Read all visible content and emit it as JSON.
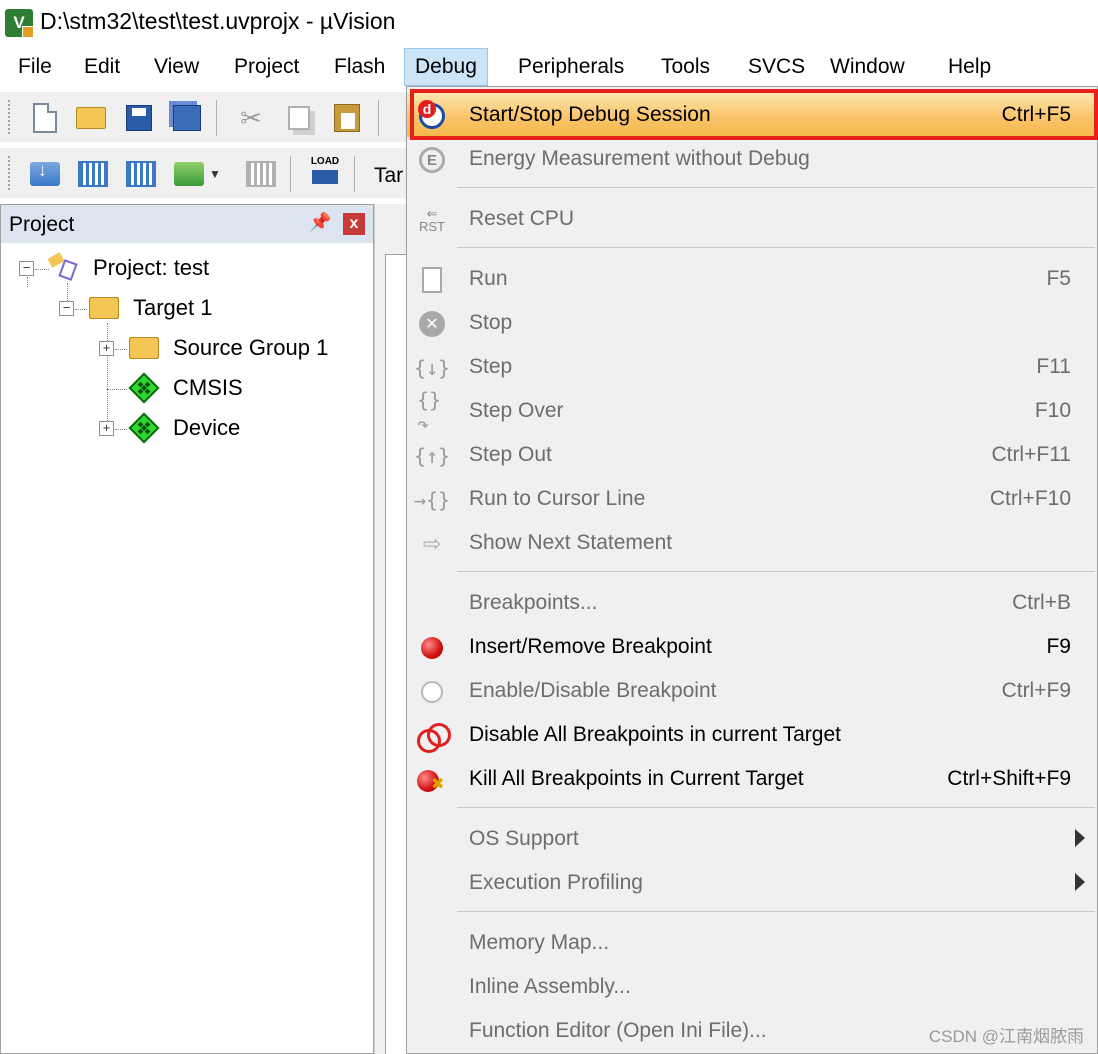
{
  "window": {
    "title": "D:\\stm32\\test\\test.uvprojx - µVision",
    "app_icon": "uvision-app-icon"
  },
  "menubar": {
    "items": [
      {
        "label": "File"
      },
      {
        "label": "Edit"
      },
      {
        "label": "View"
      },
      {
        "label": "Project"
      },
      {
        "label": "Flash"
      },
      {
        "label": "Debug",
        "active": true
      },
      {
        "label": "Peripherals"
      },
      {
        "label": "Tools"
      },
      {
        "label": "SVCS"
      },
      {
        "label": "Window"
      },
      {
        "label": "Help"
      }
    ]
  },
  "toolbar": {
    "row1_icons": [
      "new-file-icon",
      "open-folder-icon",
      "save-icon",
      "save-all-icon",
      "cut-icon",
      "copy-icon",
      "paste-icon"
    ],
    "row2_icons": [
      "translate-icon",
      "build-icon",
      "rebuild-icon",
      "batch-build-icon",
      "dropdown-arrow-icon",
      "stop-build-icon",
      "load-icon"
    ],
    "load_label": "LOAD",
    "target_partial": "Tar"
  },
  "project_panel": {
    "title": "Project",
    "pin": "⍒",
    "close": "x",
    "tree": {
      "root": "Project: test",
      "target": "Target 1",
      "children": [
        {
          "label": "Source Group 1",
          "icon": "folder-icon",
          "expandable": true
        },
        {
          "label": "CMSIS",
          "icon": "green-diamond-icon",
          "expandable": false
        },
        {
          "label": "Device",
          "icon": "green-diamond-icon",
          "expandable": true
        }
      ]
    }
  },
  "debug_menu": {
    "accent_highlight": "#f9c46a",
    "highlight_border": "#e8201c",
    "items": [
      {
        "label": "Start/Stop Debug Session",
        "shortcut": "Ctrl+F5",
        "enabled": true,
        "highlighted": true,
        "icon": "debug-session-icon"
      },
      {
        "label": "Energy Measurement without Debug",
        "shortcut": "",
        "enabled": false,
        "icon": "energy-icon"
      },
      {
        "label": "Reset CPU",
        "shortcut": "",
        "enabled": false,
        "icon": "reset-cpu-icon"
      },
      {
        "label": "Run",
        "shortcut": "F5",
        "enabled": false,
        "icon": "run-icon"
      },
      {
        "label": "Stop",
        "shortcut": "",
        "enabled": false,
        "icon": "stop-icon"
      },
      {
        "label": "Step",
        "shortcut": "F11",
        "enabled": false,
        "icon": "step-icon"
      },
      {
        "label": "Step Over",
        "shortcut": "F10",
        "enabled": false,
        "icon": "step-over-icon"
      },
      {
        "label": "Step Out",
        "shortcut": "Ctrl+F11",
        "enabled": false,
        "icon": "step-out-icon"
      },
      {
        "label": "Run to Cursor Line",
        "shortcut": "Ctrl+F10",
        "enabled": false,
        "icon": "run-to-cursor-icon"
      },
      {
        "label": "Show Next Statement",
        "shortcut": "",
        "enabled": false,
        "icon": "show-next-icon"
      },
      {
        "label": "Breakpoints...",
        "shortcut": "Ctrl+B",
        "enabled": false,
        "icon": ""
      },
      {
        "label": "Insert/Remove Breakpoint",
        "shortcut": "F9",
        "enabled": true,
        "icon": "breakpoint-icon"
      },
      {
        "label": "Enable/Disable Breakpoint",
        "shortcut": "Ctrl+F9",
        "enabled": false,
        "icon": "breakpoint-outline-icon"
      },
      {
        "label": "Disable All Breakpoints in current Target",
        "shortcut": "",
        "enabled": true,
        "icon": "disable-breakpoints-icon"
      },
      {
        "label": "Kill All Breakpoints in Current Target",
        "shortcut": "Ctrl+Shift+F9",
        "enabled": true,
        "icon": "kill-breakpoints-icon"
      },
      {
        "label": "OS Support",
        "shortcut": "",
        "enabled": false,
        "submenu": true
      },
      {
        "label": "Execution Profiling",
        "shortcut": "",
        "enabled": false,
        "submenu": true
      },
      {
        "label": "Memory Map...",
        "shortcut": "",
        "enabled": false
      },
      {
        "label": "Inline Assembly...",
        "shortcut": "",
        "enabled": false
      },
      {
        "label": "Function Editor (Open Ini File)...",
        "shortcut": "",
        "enabled": false
      }
    ]
  },
  "watermark": "CSDN @江南烟脓雨"
}
